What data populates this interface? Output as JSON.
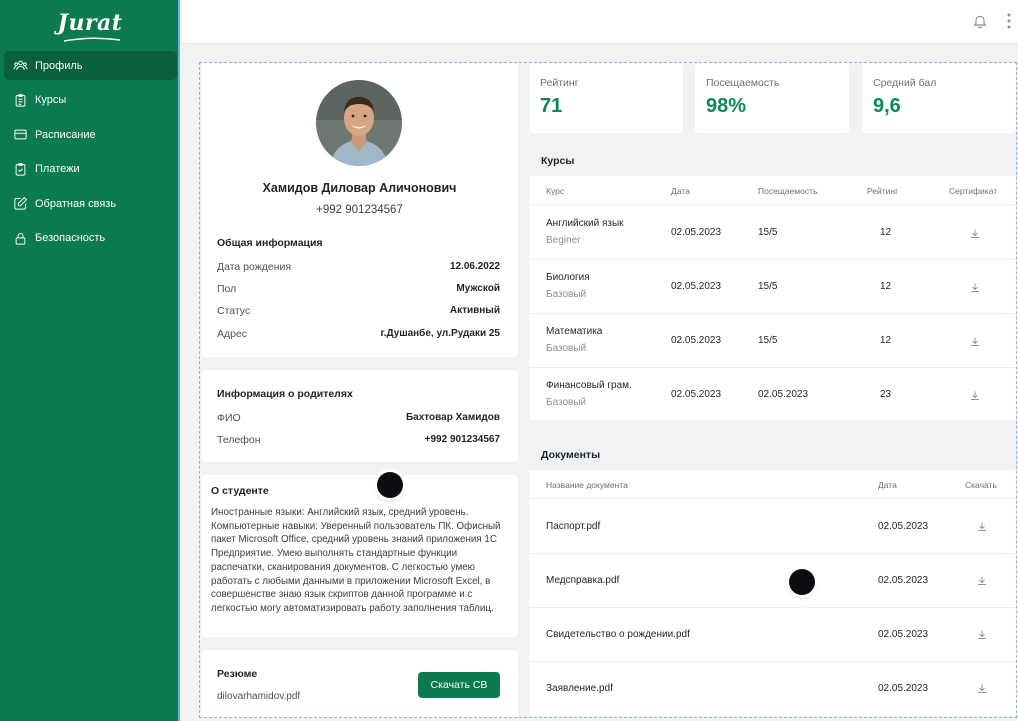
{
  "app": {
    "logo": "Jurat",
    "brand_color": "#0b7a4e"
  },
  "sidebar": {
    "items": [
      {
        "label": "Профиль",
        "icon": "users-icon",
        "active": true
      },
      {
        "label": "Курсы",
        "icon": "clipboard-list-icon",
        "active": false
      },
      {
        "label": "Расписание",
        "icon": "credit-card-icon",
        "active": false
      },
      {
        "label": "Платежи",
        "icon": "clipboard-check-icon",
        "active": false
      },
      {
        "label": "Обратная связь",
        "icon": "edit-icon",
        "active": false
      },
      {
        "label": "Безопасность",
        "icon": "lock-icon",
        "active": false
      }
    ]
  },
  "topbar": {
    "icons": [
      "bell-icon",
      "more-vertical-icon"
    ]
  },
  "profile": {
    "name": "Хамидов Диловар Аличонович",
    "phone": "+992 901234567",
    "general_title": "Общая информация",
    "fields": [
      {
        "label": "Дата рождения",
        "value": "12.06.2022"
      },
      {
        "label": "Пол",
        "value": "Мужской"
      },
      {
        "label": "Статус",
        "value": "Активный"
      },
      {
        "label": "Адрес",
        "value": "г.Душанбе, ул.Рудаки 25"
      }
    ]
  },
  "parents": {
    "title": "Информация о родителях",
    "fields": [
      {
        "label": "ФИО",
        "value": "Бахтовар Хамидов"
      },
      {
        "label": "Телефон",
        "value": "+992 901234567"
      }
    ]
  },
  "about": {
    "title": "О студенте",
    "text": "Иностранные языки: Английский язык, средний уровень. Компьютерные навыки: Уверенный пользователь ПК. Офисный пакет Microsoft Office, средний уровень знаний приложения 1С Предприятие. Умею выполнять стандартные функции распечатки, сканирования документов. С легкостью умею работать с любыми данными в приложении Microsoft Excel, в совершенстве знаю язык скриптов данной программе и с легкостью могу автоматизировать работу заполнения таблиц."
  },
  "resume": {
    "title": "Резюме",
    "file": "dilovarhamidov.pdf",
    "button": "Скачать CB"
  },
  "stats": [
    {
      "label": "Рейтинг",
      "value": "71"
    },
    {
      "label": "Посещаемость",
      "value": "98%"
    },
    {
      "label": "Средний бал",
      "value": "9,6"
    }
  ],
  "courses": {
    "title": "Курсы",
    "headers": [
      "Курс",
      "Дата",
      "Посещаемость",
      "Рейтинг",
      "Сертификат"
    ],
    "rows": [
      {
        "name": "Английский язык",
        "level": "Beginer",
        "date": "02.05.2023",
        "attendance": "15/5",
        "rating": "12"
      },
      {
        "name": "Биология",
        "level": "Базовый",
        "date": "02.05.2023",
        "attendance": "15/5",
        "rating": "12"
      },
      {
        "name": "Математика",
        "level": "Базовый",
        "date": "02.05.2023",
        "attendance": "15/5",
        "rating": "12"
      },
      {
        "name": "Финансовый грам.",
        "level": "Базовый",
        "date": "02.05.2023",
        "attendance": "02.05.2023",
        "rating": "23"
      }
    ]
  },
  "documents": {
    "title": "Документы",
    "headers": [
      "Название документа",
      "Дата",
      "Скачать"
    ],
    "rows": [
      {
        "name": "Паспорт.pdf",
        "date": "02.05.2023"
      },
      {
        "name": "Медсправка.pdf",
        "date": "02.05.2023"
      },
      {
        "name": "Свидетельство о рождении.pdf",
        "date": "02.05.2023"
      },
      {
        "name": "Заявление.pdf",
        "date": "02.05.2023"
      }
    ]
  }
}
